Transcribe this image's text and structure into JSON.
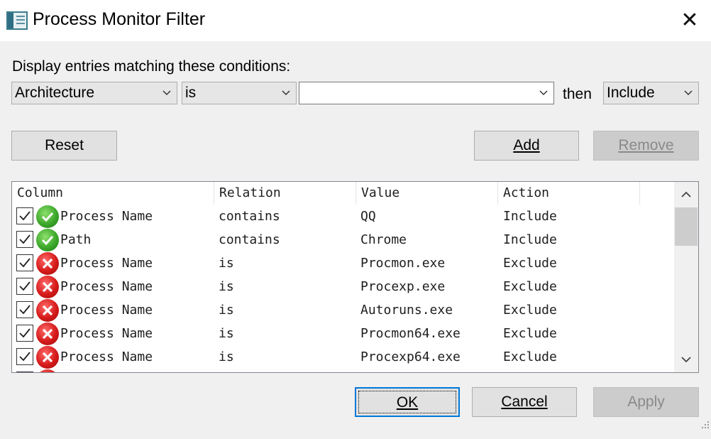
{
  "window": {
    "title": "Process Monitor Filter"
  },
  "conditions": {
    "label": "Display entries matching these conditions:",
    "column_value": "Architecture",
    "relation_value": "is",
    "value_input": "",
    "then_label": "then",
    "action_value": "Include"
  },
  "buttons": {
    "reset": "Reset",
    "add": "Add",
    "remove": "Remove",
    "ok": "OK",
    "cancel": "Cancel",
    "apply": "Apply"
  },
  "table": {
    "headers": [
      "Column",
      "Relation",
      "Value",
      "Action"
    ],
    "rows": [
      {
        "checked": true,
        "status": "include",
        "column": "Process Name",
        "relation": "contains",
        "value": "QQ",
        "action": "Include"
      },
      {
        "checked": true,
        "status": "include",
        "column": "Path",
        "relation": "contains",
        "value": "Chrome",
        "action": "Include"
      },
      {
        "checked": true,
        "status": "exclude",
        "column": "Process Name",
        "relation": "is",
        "value": "Procmon.exe",
        "action": "Exclude"
      },
      {
        "checked": true,
        "status": "exclude",
        "column": "Process Name",
        "relation": "is",
        "value": "Procexp.exe",
        "action": "Exclude"
      },
      {
        "checked": true,
        "status": "exclude",
        "column": "Process Name",
        "relation": "is",
        "value": "Autoruns.exe",
        "action": "Exclude"
      },
      {
        "checked": true,
        "status": "exclude",
        "column": "Process Name",
        "relation": "is",
        "value": "Procmon64.exe",
        "action": "Exclude"
      },
      {
        "checked": true,
        "status": "exclude",
        "column": "Process Name",
        "relation": "is",
        "value": "Procexp64.exe",
        "action": "Exclude"
      }
    ]
  },
  "colors": {
    "include_icon": "#3ca72a",
    "exclude_icon": "#d61a1a",
    "focus_border": "#0078d7"
  }
}
